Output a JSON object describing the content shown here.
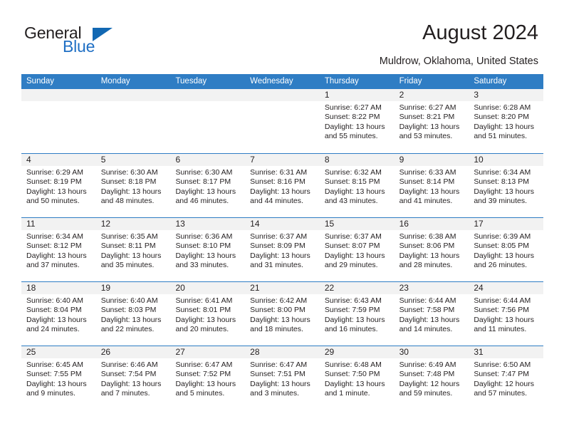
{
  "brand": {
    "line1": "General",
    "line2": "Blue",
    "triangle_color": "#1268b3"
  },
  "header": {
    "title": "August 2024",
    "subtitle": "Muldrow, Oklahoma, United States"
  },
  "theme": {
    "header_blue": "#2f7dc4",
    "day_band_gray": "#f2f2f2",
    "text": "#231f20"
  },
  "weekdays": [
    "Sunday",
    "Monday",
    "Tuesday",
    "Wednesday",
    "Thursday",
    "Friday",
    "Saturday"
  ],
  "weeks": [
    [
      {
        "day": "",
        "sunrise": "",
        "sunset": "",
        "daylight_1": "",
        "daylight_2": ""
      },
      {
        "day": "",
        "sunrise": "",
        "sunset": "",
        "daylight_1": "",
        "daylight_2": ""
      },
      {
        "day": "",
        "sunrise": "",
        "sunset": "",
        "daylight_1": "",
        "daylight_2": ""
      },
      {
        "day": "",
        "sunrise": "",
        "sunset": "",
        "daylight_1": "",
        "daylight_2": ""
      },
      {
        "day": "1",
        "sunrise": "Sunrise: 6:27 AM",
        "sunset": "Sunset: 8:22 PM",
        "daylight_1": "Daylight: 13 hours",
        "daylight_2": "and 55 minutes."
      },
      {
        "day": "2",
        "sunrise": "Sunrise: 6:27 AM",
        "sunset": "Sunset: 8:21 PM",
        "daylight_1": "Daylight: 13 hours",
        "daylight_2": "and 53 minutes."
      },
      {
        "day": "3",
        "sunrise": "Sunrise: 6:28 AM",
        "sunset": "Sunset: 8:20 PM",
        "daylight_1": "Daylight: 13 hours",
        "daylight_2": "and 51 minutes."
      }
    ],
    [
      {
        "day": "4",
        "sunrise": "Sunrise: 6:29 AM",
        "sunset": "Sunset: 8:19 PM",
        "daylight_1": "Daylight: 13 hours",
        "daylight_2": "and 50 minutes."
      },
      {
        "day": "5",
        "sunrise": "Sunrise: 6:30 AM",
        "sunset": "Sunset: 8:18 PM",
        "daylight_1": "Daylight: 13 hours",
        "daylight_2": "and 48 minutes."
      },
      {
        "day": "6",
        "sunrise": "Sunrise: 6:30 AM",
        "sunset": "Sunset: 8:17 PM",
        "daylight_1": "Daylight: 13 hours",
        "daylight_2": "and 46 minutes."
      },
      {
        "day": "7",
        "sunrise": "Sunrise: 6:31 AM",
        "sunset": "Sunset: 8:16 PM",
        "daylight_1": "Daylight: 13 hours",
        "daylight_2": "and 44 minutes."
      },
      {
        "day": "8",
        "sunrise": "Sunrise: 6:32 AM",
        "sunset": "Sunset: 8:15 PM",
        "daylight_1": "Daylight: 13 hours",
        "daylight_2": "and 43 minutes."
      },
      {
        "day": "9",
        "sunrise": "Sunrise: 6:33 AM",
        "sunset": "Sunset: 8:14 PM",
        "daylight_1": "Daylight: 13 hours",
        "daylight_2": "and 41 minutes."
      },
      {
        "day": "10",
        "sunrise": "Sunrise: 6:34 AM",
        "sunset": "Sunset: 8:13 PM",
        "daylight_1": "Daylight: 13 hours",
        "daylight_2": "and 39 minutes."
      }
    ],
    [
      {
        "day": "11",
        "sunrise": "Sunrise: 6:34 AM",
        "sunset": "Sunset: 8:12 PM",
        "daylight_1": "Daylight: 13 hours",
        "daylight_2": "and 37 minutes."
      },
      {
        "day": "12",
        "sunrise": "Sunrise: 6:35 AM",
        "sunset": "Sunset: 8:11 PM",
        "daylight_1": "Daylight: 13 hours",
        "daylight_2": "and 35 minutes."
      },
      {
        "day": "13",
        "sunrise": "Sunrise: 6:36 AM",
        "sunset": "Sunset: 8:10 PM",
        "daylight_1": "Daylight: 13 hours",
        "daylight_2": "and 33 minutes."
      },
      {
        "day": "14",
        "sunrise": "Sunrise: 6:37 AM",
        "sunset": "Sunset: 8:09 PM",
        "daylight_1": "Daylight: 13 hours",
        "daylight_2": "and 31 minutes."
      },
      {
        "day": "15",
        "sunrise": "Sunrise: 6:37 AM",
        "sunset": "Sunset: 8:07 PM",
        "daylight_1": "Daylight: 13 hours",
        "daylight_2": "and 29 minutes."
      },
      {
        "day": "16",
        "sunrise": "Sunrise: 6:38 AM",
        "sunset": "Sunset: 8:06 PM",
        "daylight_1": "Daylight: 13 hours",
        "daylight_2": "and 28 minutes."
      },
      {
        "day": "17",
        "sunrise": "Sunrise: 6:39 AM",
        "sunset": "Sunset: 8:05 PM",
        "daylight_1": "Daylight: 13 hours",
        "daylight_2": "and 26 minutes."
      }
    ],
    [
      {
        "day": "18",
        "sunrise": "Sunrise: 6:40 AM",
        "sunset": "Sunset: 8:04 PM",
        "daylight_1": "Daylight: 13 hours",
        "daylight_2": "and 24 minutes."
      },
      {
        "day": "19",
        "sunrise": "Sunrise: 6:40 AM",
        "sunset": "Sunset: 8:03 PM",
        "daylight_1": "Daylight: 13 hours",
        "daylight_2": "and 22 minutes."
      },
      {
        "day": "20",
        "sunrise": "Sunrise: 6:41 AM",
        "sunset": "Sunset: 8:01 PM",
        "daylight_1": "Daylight: 13 hours",
        "daylight_2": "and 20 minutes."
      },
      {
        "day": "21",
        "sunrise": "Sunrise: 6:42 AM",
        "sunset": "Sunset: 8:00 PM",
        "daylight_1": "Daylight: 13 hours",
        "daylight_2": "and 18 minutes."
      },
      {
        "day": "22",
        "sunrise": "Sunrise: 6:43 AM",
        "sunset": "Sunset: 7:59 PM",
        "daylight_1": "Daylight: 13 hours",
        "daylight_2": "and 16 minutes."
      },
      {
        "day": "23",
        "sunrise": "Sunrise: 6:44 AM",
        "sunset": "Sunset: 7:58 PM",
        "daylight_1": "Daylight: 13 hours",
        "daylight_2": "and 14 minutes."
      },
      {
        "day": "24",
        "sunrise": "Sunrise: 6:44 AM",
        "sunset": "Sunset: 7:56 PM",
        "daylight_1": "Daylight: 13 hours",
        "daylight_2": "and 11 minutes."
      }
    ],
    [
      {
        "day": "25",
        "sunrise": "Sunrise: 6:45 AM",
        "sunset": "Sunset: 7:55 PM",
        "daylight_1": "Daylight: 13 hours",
        "daylight_2": "and 9 minutes."
      },
      {
        "day": "26",
        "sunrise": "Sunrise: 6:46 AM",
        "sunset": "Sunset: 7:54 PM",
        "daylight_1": "Daylight: 13 hours",
        "daylight_2": "and 7 minutes."
      },
      {
        "day": "27",
        "sunrise": "Sunrise: 6:47 AM",
        "sunset": "Sunset: 7:52 PM",
        "daylight_1": "Daylight: 13 hours",
        "daylight_2": "and 5 minutes."
      },
      {
        "day": "28",
        "sunrise": "Sunrise: 6:47 AM",
        "sunset": "Sunset: 7:51 PM",
        "daylight_1": "Daylight: 13 hours",
        "daylight_2": "and 3 minutes."
      },
      {
        "day": "29",
        "sunrise": "Sunrise: 6:48 AM",
        "sunset": "Sunset: 7:50 PM",
        "daylight_1": "Daylight: 13 hours",
        "daylight_2": "and 1 minute."
      },
      {
        "day": "30",
        "sunrise": "Sunrise: 6:49 AM",
        "sunset": "Sunset: 7:48 PM",
        "daylight_1": "Daylight: 12 hours",
        "daylight_2": "and 59 minutes."
      },
      {
        "day": "31",
        "sunrise": "Sunrise: 6:50 AM",
        "sunset": "Sunset: 7:47 PM",
        "daylight_1": "Daylight: 12 hours",
        "daylight_2": "and 57 minutes."
      }
    ]
  ]
}
